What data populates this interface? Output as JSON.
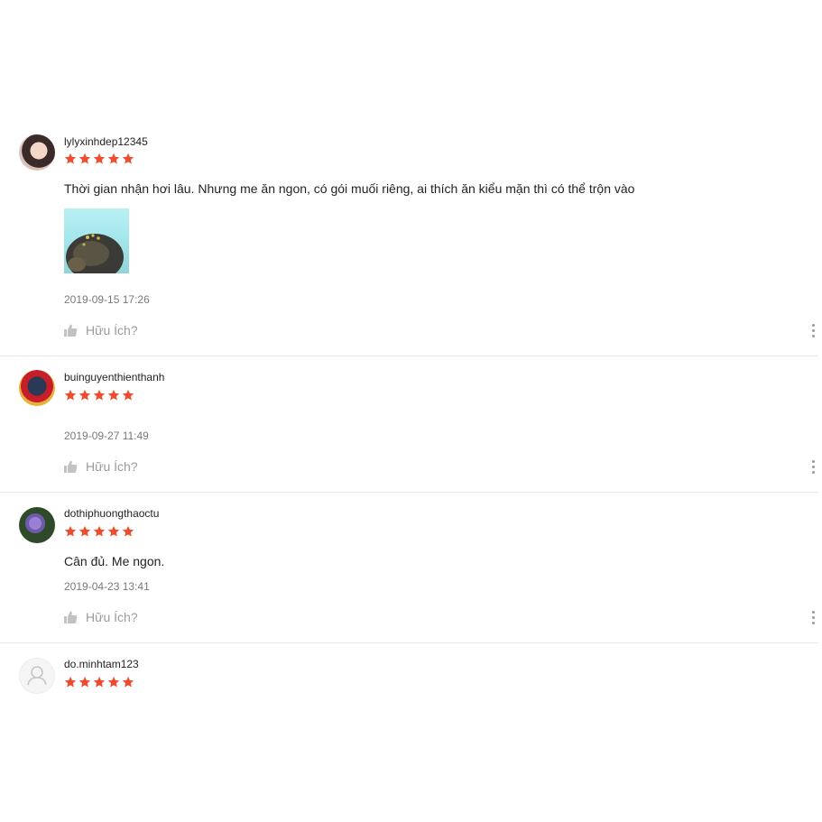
{
  "reviews": [
    {
      "username": "lylyxinhdep12345",
      "rating": 5,
      "comment": "Thời gian nhận hơi lâu. Nhưng me ăn ngon, có gói muối riêng, ai thích ăn kiểu mặn thì có thể trộn vào",
      "date": "2019-09-15 17:26",
      "helpful_label": "Hữu Ích?"
    },
    {
      "username": "buinguyenthienthanh",
      "rating": 5,
      "date": "2019-09-27 11:49",
      "helpful_label": "Hữu Ích?"
    },
    {
      "username": "dothiphuongthaoctu",
      "rating": 5,
      "comment": "Cân đủ. Me ngon.",
      "date": "2019-04-23 13:41",
      "helpful_label": "Hữu Ích?"
    },
    {
      "username": "do.minhtam123",
      "rating": 5
    }
  ],
  "colors": {
    "star": "#ee4d2d",
    "divider": "#e8e8e8",
    "muted": "#999999"
  },
  "icons": {
    "star": "star-icon",
    "thumb": "thumbs-up-icon",
    "more": "more-vertical-icon",
    "default_avatar": "user-icon"
  }
}
